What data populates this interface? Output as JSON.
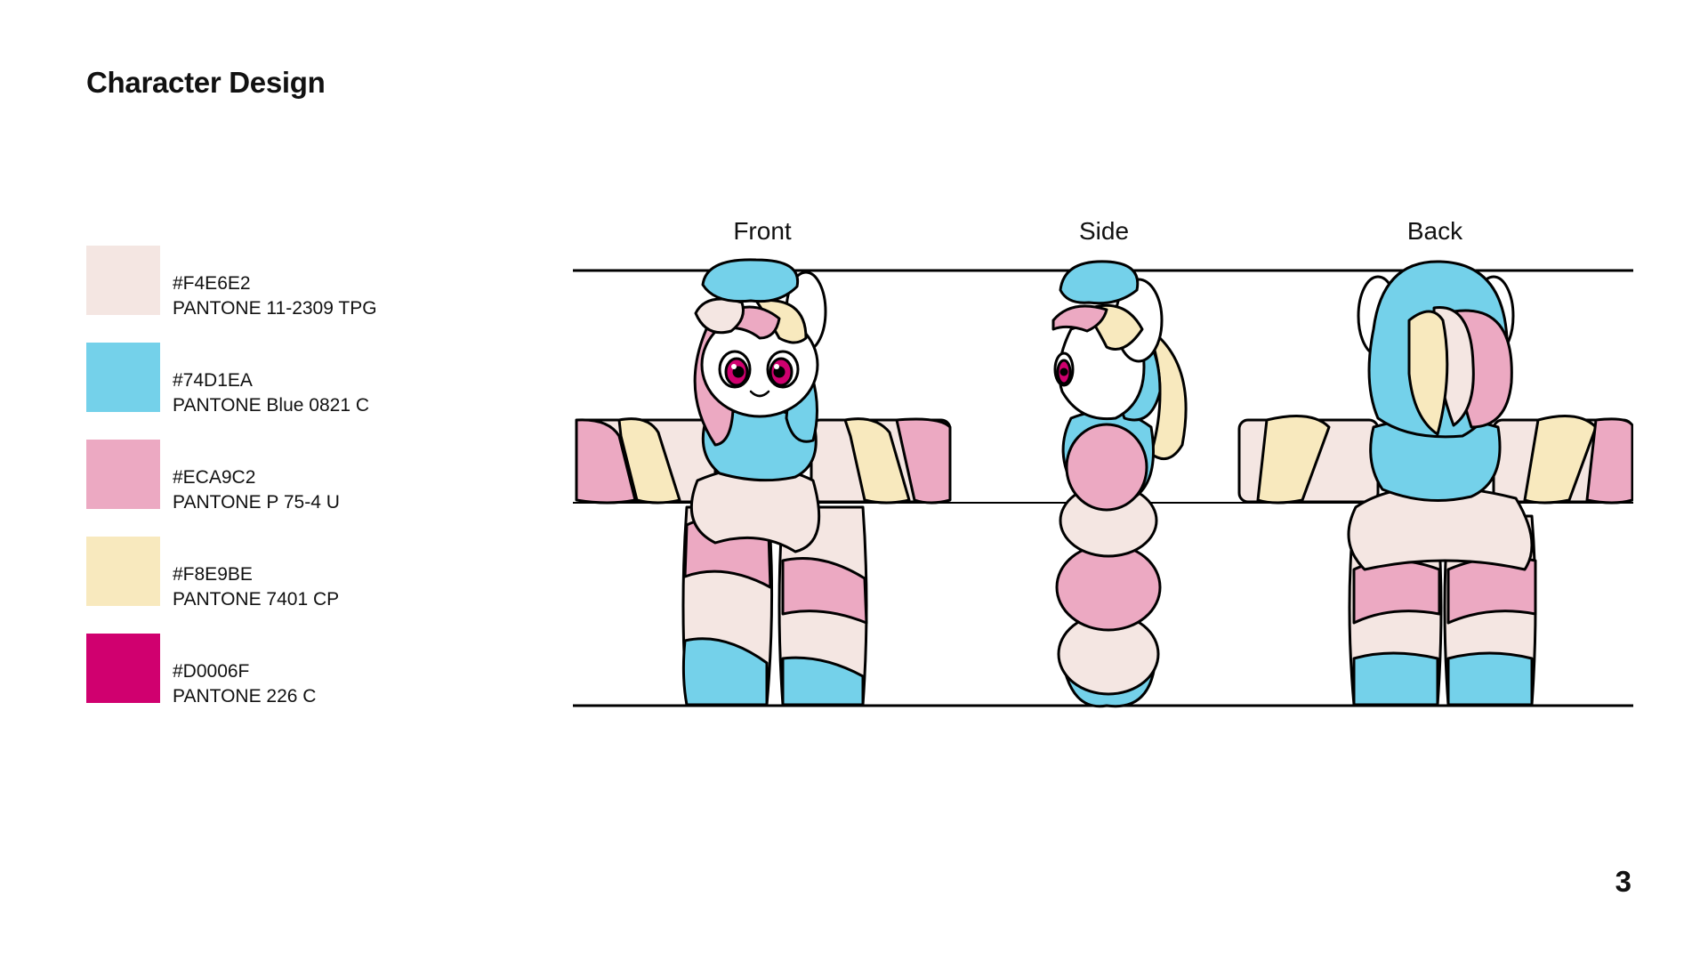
{
  "page": {
    "title": "Character Design",
    "page_number": "3"
  },
  "palette": [
    {
      "hex": "#F4E6E2",
      "pantone": "PANTONE 11-2309 TPG",
      "color": "#F4E6E2"
    },
    {
      "hex": "#74D1EA",
      "pantone": "PANTONE Blue 0821 C",
      "color": "#74D1EA"
    },
    {
      "hex": "#ECA9C2",
      "pantone": "PANTONE P 75-4 U",
      "color": "#ECA9C2"
    },
    {
      "hex": "#F8E9BE",
      "pantone": "PANTONE 7401 CP",
      "color": "#F8E9BE"
    },
    {
      "hex": "#D0006F",
      "pantone": "PANTONE 226 C",
      "color": "#D0006F"
    }
  ],
  "views": {
    "front": "Front",
    "side": "Side",
    "back": "Back"
  },
  "colors": {
    "outline": "#000000",
    "face": "#FFFFFF"
  }
}
